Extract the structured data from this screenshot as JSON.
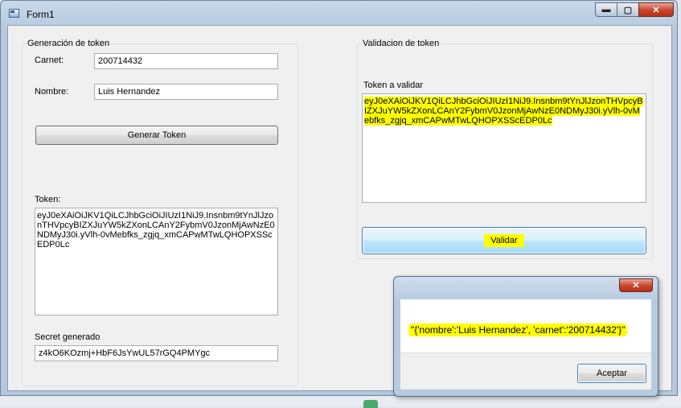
{
  "window": {
    "title": "Form1",
    "minimize_label": "▬",
    "maximize_label": "▢",
    "close_label": "✕"
  },
  "gen_group": {
    "title": "Generación de token",
    "carnet_label": "Carnet:",
    "carnet_value": "200714432",
    "nombre_label": "Nombre:",
    "nombre_value": "Luis Hernandez",
    "button_label": "Generar Token",
    "token_label": "Token:",
    "token_value": "eyJ0eXAiOiJKV1QiLCJhbGciOiJIUzI1NiJ9.Insnbm9tYnJlJzonTHVpcyBIZXJuYW5kZXonLCAnY2FybmV0JzonMjAwNzE0NDMyJ30i.yVlh-0vMebfks_zgjq_xmCAPwMTwLQHOPXSScEDP0Lc",
    "secret_label": "Secret generado",
    "secret_value": "z4kO6KOzmj+HbF6JsYwUL57rGQ4PMYgc"
  },
  "val_group": {
    "title": "Validacion de token",
    "token_label": "Token a validar",
    "token_value": "eyJ0eXAiOiJKV1QiLCJhbGciOiJIUzI1NiJ9.Insnbm9tYnJlJzonTHVpcyBIZXJuYW5kZXonLCAnY2FybmV0JzonMjAwNzE0NDMyJ30i.yVlh-0vMebfks_zgjq_xmCAPwMTwLQHOPXSScEDP0Lc",
    "button_label": "Validar"
  },
  "dialog": {
    "close_label": "✕",
    "message": "\"{'nombre':'Luis Hernandez', 'carnet':'200714432'}\"",
    "ok_label": "Aceptar"
  },
  "colors": {
    "highlight": "#ffff00",
    "title_bar": "#b3c8de",
    "close_button": "#c7432c"
  }
}
